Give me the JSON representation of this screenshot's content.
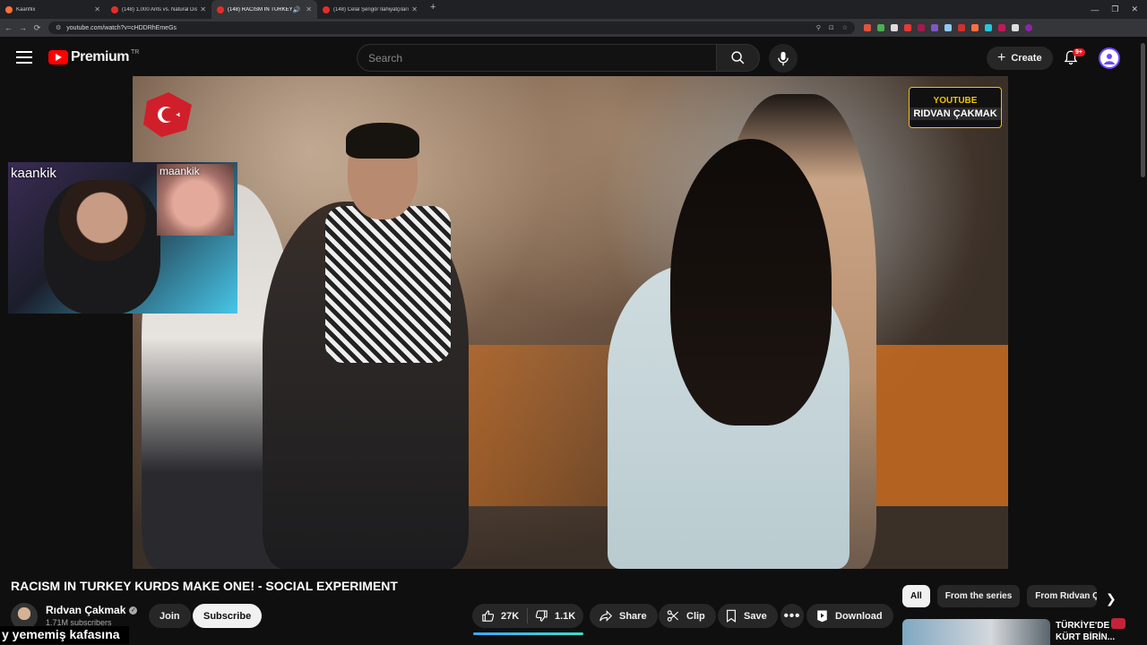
{
  "browser": {
    "tabs": [
      {
        "title": "Kaanflix",
        "active": false,
        "audio": false
      },
      {
        "title": "(148) 1,000 Ants vs. Natural Disa",
        "active": false,
        "audio": false
      },
      {
        "title": "(148) RACISM IN TURKEY K",
        "active": true,
        "audio": true
      },
      {
        "title": "(148) Celal Şengör İlahiyatçıları",
        "active": false,
        "audio": false
      }
    ],
    "url": "youtube.com/watch?v=cHDDRhEmeGs",
    "new_tab_symbol": "+"
  },
  "header": {
    "brand": "Premium",
    "country_code": "TR",
    "search_placeholder": "Search",
    "create_label": "Create",
    "notification_count": "9+"
  },
  "video": {
    "watermark_top": "YOUTUBE",
    "watermark_name": "RIDVAN ÇAKMAK",
    "webcam_main_label": "kaankik",
    "webcam_second_label": "maankik",
    "progress_fraction": 0.5,
    "caption_overlay": "y yememiş kafasına"
  },
  "info": {
    "title": "RACISM IN TURKEY KURDS MAKE ONE! - SOCIAL EXPERIMENT",
    "channel_name": "Rıdvan Çakmak",
    "subscribers": "1.71M subscribers",
    "join_label": "Join",
    "subscribe_label": "Subscribe",
    "likes": "27K",
    "dislikes": "1.1K",
    "share_label": "Share",
    "clip_label": "Clip",
    "save_label": "Save",
    "download_label": "Download"
  },
  "sidebar": {
    "chips": [
      {
        "label": "All",
        "active": true
      },
      {
        "label": "From the series",
        "active": false
      },
      {
        "label": "From Rıdvan Ç",
        "active": false
      }
    ],
    "recommendation_title_line1": "TÜRKİYE'DE",
    "recommendation_title_line2": "KÜRT BİRİN..."
  },
  "colors": {
    "background": "#0f0f0f",
    "accent_red": "#ff0000",
    "chip_bg": "#272727",
    "progress_start": "#3ea6ff",
    "progress_end": "#3ae0c6"
  }
}
